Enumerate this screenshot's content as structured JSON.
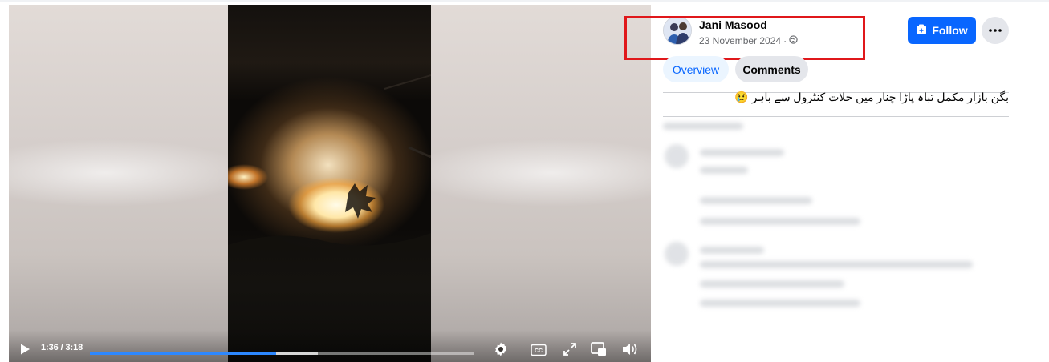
{
  "video": {
    "current_time": "1:36",
    "duration": "3:18",
    "time_label": "1:36 / 3:18",
    "played_fraction": 0.485,
    "buffered_fraction": 0.595,
    "controls": {
      "play_icon": "play-icon",
      "settings_icon": "gear-icon",
      "captions_icon": "closed-captions-icon",
      "fullscreen_icon": "expand-icon",
      "pip_icon": "picture-in-picture-icon",
      "volume_icon": "volume-icon"
    },
    "progress_color": "#2d88ff"
  },
  "post": {
    "author": "Jani Masood",
    "date": "23 November 2024",
    "separator": "·",
    "audience_icon": "globe-icon",
    "caption": "بگن بازار مکمل تباہ پاڑا چنار میں حلات کنٹرول سے باہر 😢",
    "highlight_color": "#e0181b"
  },
  "actions": {
    "follow_label": "Follow",
    "follow_color": "#0866ff",
    "more_icon": "more-horizontal-icon"
  },
  "tabs": [
    {
      "label": "Overview",
      "active": true
    },
    {
      "label": "Comments",
      "active": false
    }
  ]
}
